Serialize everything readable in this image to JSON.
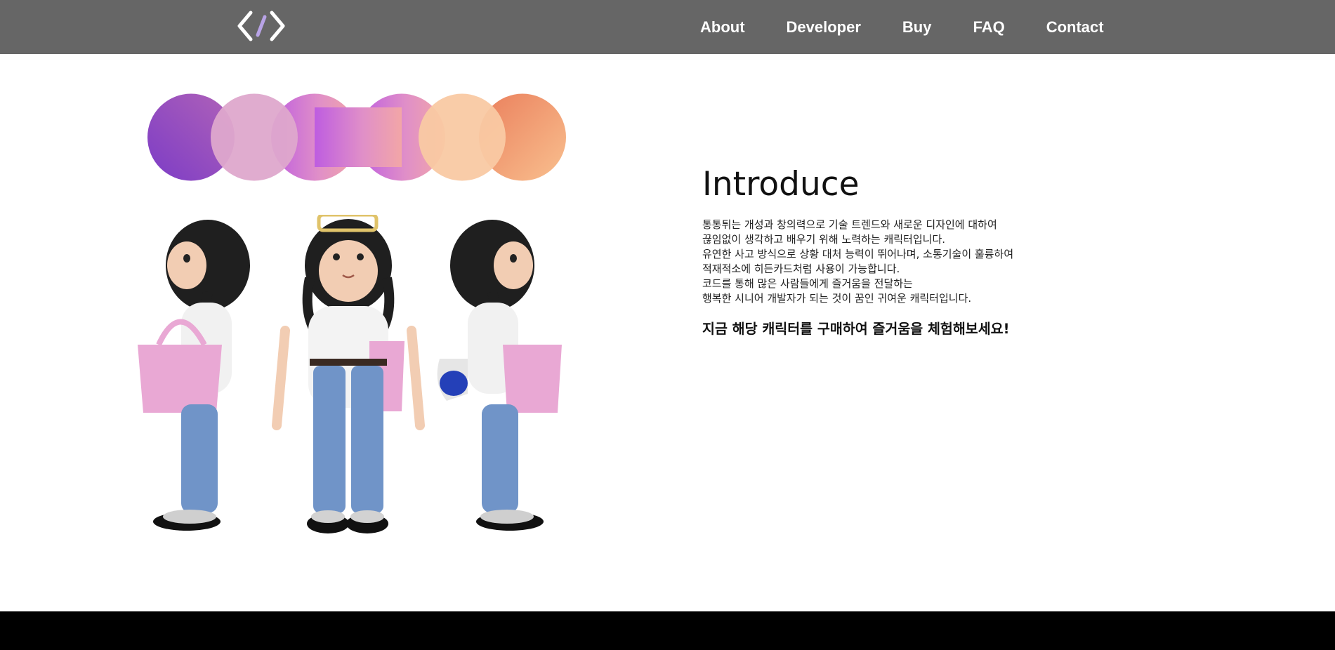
{
  "header": {
    "logo_icon": "code-brackets-icon",
    "nav": [
      {
        "label": "About"
      },
      {
        "label": "Developer"
      },
      {
        "label": "Buy"
      },
      {
        "label": "FAQ"
      },
      {
        "label": "Contact"
      }
    ]
  },
  "intro": {
    "title": "Introduce",
    "paragraph_lines": [
      "통통튀는 개성과 창의력으로 기술 트렌드와 새로운 디자인에 대하여",
      "끊임없이 생각하고 배우기 위해 노력하는 캐릭터입니다.",
      "유연한 사고 방식으로 상황 대처 능력이 뛰어나며, 소통기술이 훌륭하여",
      "적재적소에 히든카드처럼 사용이 가능합니다.",
      "코드를 통해 많은 사람들에게 즐거움을 전달하는",
      "행복한 시니어 개발자가 되는 것이 꿈인 귀여운 캐릭터입니다."
    ],
    "cta": "지금 해당 캐릭터를 구매하여 즐거움을 체험해보세요!"
  },
  "colors": {
    "header_bg": "#666666",
    "footer_bg": "#000000",
    "purple": "#8a44c6",
    "pink": "#dda6c8",
    "peach": "#f9c9a3",
    "orange": "#ef8a63"
  }
}
